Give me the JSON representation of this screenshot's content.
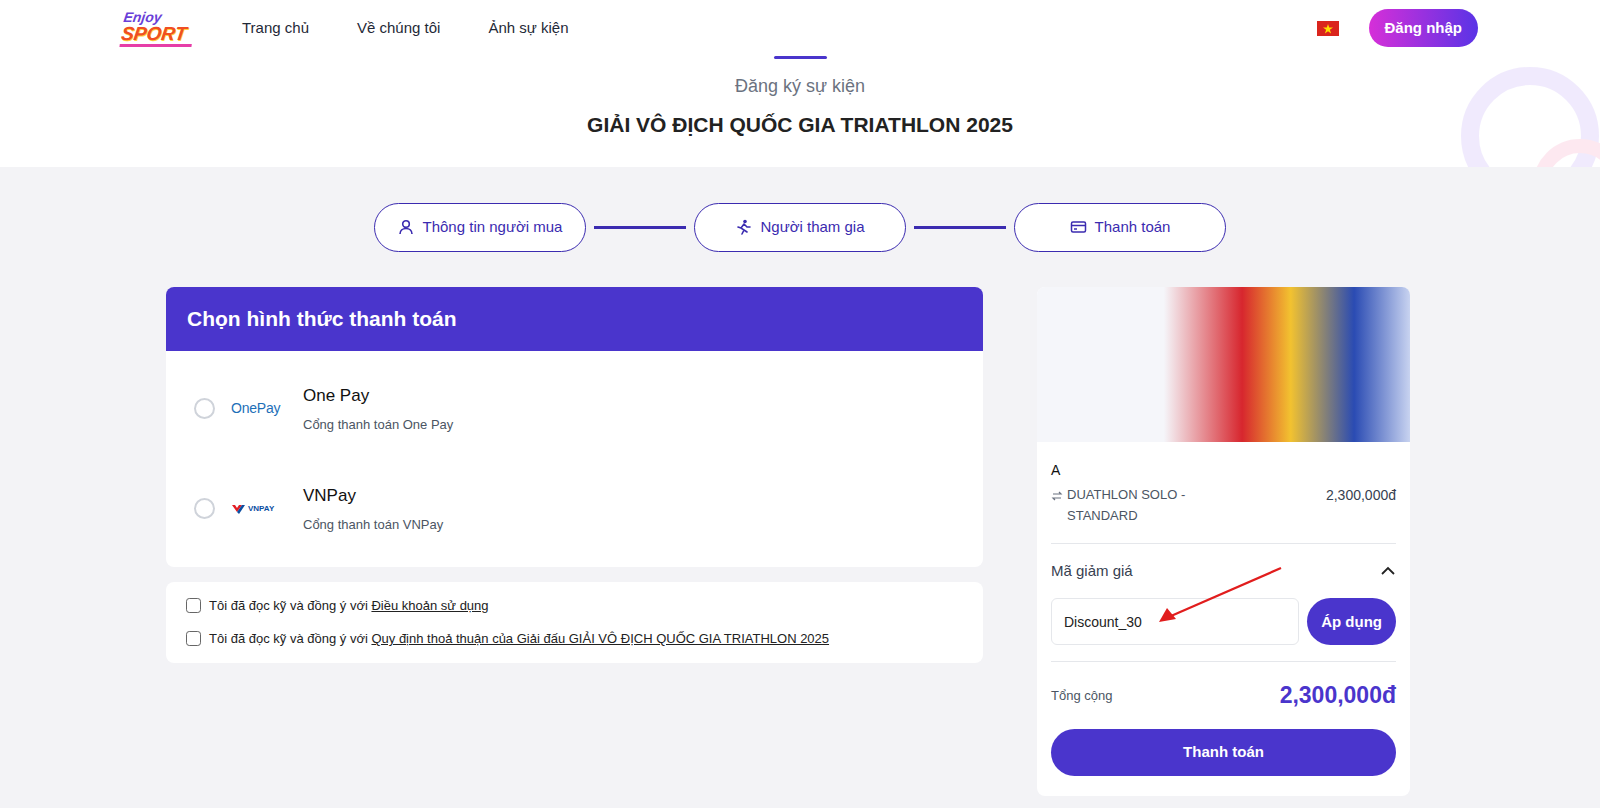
{
  "header": {
    "logo": {
      "top": "Enjoy",
      "bottom": "SPORT"
    },
    "nav": [
      "Trang chủ",
      "Về chúng tôi",
      "Ảnh sự kiện"
    ],
    "login": "Đăng nhập"
  },
  "page": {
    "subtitle": "Đăng ký sự kiện",
    "title": "GIẢI VÔ ĐỊCH QUỐC GIA TRIATHLON 2025"
  },
  "steps": [
    {
      "label": "Thông tin người mua",
      "kind": "user"
    },
    {
      "label": "Người tham gia",
      "kind": "runner"
    },
    {
      "label": "Thanh toán",
      "kind": "card"
    }
  ],
  "payment": {
    "title": "Chọn hình thức thanh toán",
    "methods": [
      {
        "logo": "OnePay",
        "name": "One Pay",
        "desc": "Cổng thanh toán One Pay",
        "selected": false,
        "kind": "onepay"
      },
      {
        "logo": "VNPAY",
        "name": "VNPay",
        "desc": "Cổng thanh toán VNPay",
        "selected": false,
        "kind": "vnpay"
      }
    ]
  },
  "terms": [
    {
      "text": "Tôi đã đọc kỹ và đồng ý với ",
      "link": "Điều khoản sử dụng",
      "checked": false
    },
    {
      "text": "Tôi đã đọc kỹ và đồng ý với ",
      "link": "Quy định thoả thuận của Giải đấu GIẢI VÔ ĐỊCH QUỐC GIA TRIATHLON 2025",
      "checked": false
    }
  ],
  "summary": {
    "participant": "A",
    "ticket": "DUATHLON SOLO - STANDARD",
    "price": "2,300,000đ",
    "discount": {
      "label": "Mã giảm giá",
      "expanded": true,
      "value": "Discount_30",
      "apply": "Áp dụng"
    },
    "total_label": "Tổng cộng",
    "total": "2,300,000đ",
    "pay": "Thanh toán"
  }
}
